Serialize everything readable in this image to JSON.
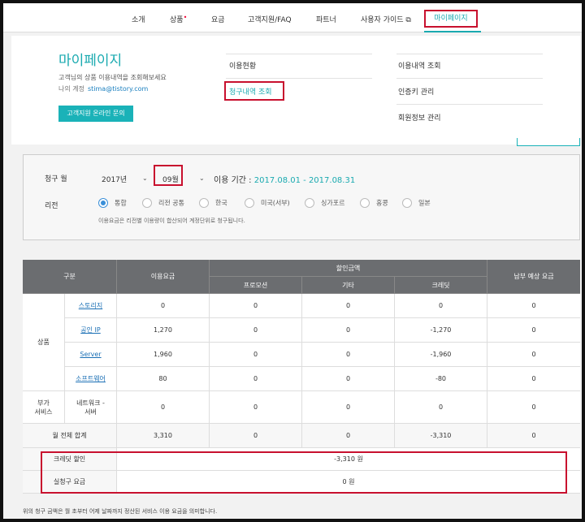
{
  "nav": {
    "items": [
      "소개",
      "상품",
      "요금",
      "고객지원/FAQ",
      "파트너",
      "사용자 가이드 ⧉"
    ],
    "active": "마이페이지",
    "product_dot": "•"
  },
  "mypage": {
    "title": "마이페이지",
    "subtitle": "고객님의 상품 이용내역을 조회해보세요",
    "account_label": "나의 계정",
    "account_email": "stima@tistory.com",
    "support_button": "고객지원 온라인 문의",
    "links_mid": [
      "이용현황",
      "청구내역 조회"
    ],
    "links_right": [
      "이용내역 조회",
      "인증키 관리",
      "회원정보 관리"
    ]
  },
  "filter": {
    "month_label": "청구 월",
    "year": "2017년",
    "month": "09월",
    "period_label": "이용 기간 :",
    "period_value": "2017.08.01 - 2017.08.31",
    "region_label": "리전",
    "regions": [
      "통합",
      "리전 공통",
      "한국",
      "미국(서부)",
      "싱가포르",
      "홍콩",
      "일본"
    ],
    "selected_region": "통합",
    "note": "이용요금은 리전별 이용량이 합산되어 계정단위로 청구됩니다."
  },
  "table": {
    "headers": {
      "category": "구분",
      "usage": "이용요금",
      "discount": "할인금액",
      "promotion": "프로모션",
      "etc": "기타",
      "credit": "크레딧",
      "expected": "납부 예상 요금"
    },
    "group_products": "상품",
    "group_addon": "부가\n서비스",
    "rows": [
      {
        "name": "스토리지",
        "usage": "0",
        "promotion": "0",
        "etc": "0",
        "credit": "0",
        "expected": "0"
      },
      {
        "name": "공인 IP",
        "usage": "1,270",
        "promotion": "0",
        "etc": "0",
        "credit": "-1,270",
        "expected": "0"
      },
      {
        "name": "Server",
        "usage": "1,960",
        "promotion": "0",
        "etc": "0",
        "credit": "-1,960",
        "expected": "0"
      },
      {
        "name": "소프트웨어",
        "usage": "80",
        "promotion": "0",
        "etc": "0",
        "credit": "-80",
        "expected": "0"
      },
      {
        "name": "네트워크 -\n서버",
        "usage": "0",
        "promotion": "0",
        "etc": "0",
        "credit": "0",
        "expected": "0"
      }
    ],
    "total": {
      "label": "월 전체 합계",
      "usage": "3,310",
      "promotion": "0",
      "etc": "0",
      "credit": "-3,310",
      "expected": "0"
    },
    "credit_discount_label": "크레딧 할인",
    "credit_discount_value": "-3,310 원",
    "actual_label": "실청구 요금",
    "actual_value": "0 원"
  },
  "footer_note": "위의 청구 금액은 월 초부터 어제 날짜까지 정산된 서비스 이용 요금을 의미합니다."
}
